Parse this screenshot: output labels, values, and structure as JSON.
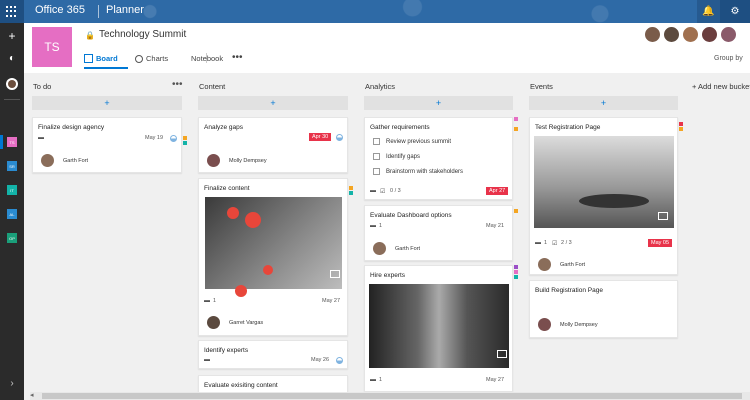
{
  "app": {
    "suite": "Office 365",
    "name": "Planner"
  },
  "rail": {
    "add_icon": "+",
    "hub_icon": "◐",
    "plans": [
      {
        "label": "TS",
        "color": "#e56ec3"
      },
      {
        "label": "SR",
        "color": "#2a8bd0"
      },
      {
        "label": "IT",
        "color": "#13b3a8"
      },
      {
        "label": "AL",
        "color": "#2a8bd0"
      },
      {
        "label": "OP",
        "color": "#1a9f7a"
      }
    ],
    "expand_icon": "›"
  },
  "plan": {
    "initials": "TS",
    "title": "Technology Summit",
    "tile_color": "#e56ec3",
    "tabs": [
      {
        "label": "Board",
        "active": true
      },
      {
        "label": "Charts",
        "active": false
      },
      {
        "label": "Notebook",
        "active": false
      }
    ],
    "more": "•••",
    "group_by": "Group by"
  },
  "buckets": [
    {
      "name": "To do",
      "more": "•••",
      "add": "+"
    },
    {
      "name": "Content",
      "add": "+"
    },
    {
      "name": "Analytics",
      "add": "+"
    },
    {
      "name": "Events",
      "add": "+"
    }
  ],
  "add_bucket": "+ Add new bucket",
  "cards": {
    "finalize_design": {
      "title": "Finalize design agency",
      "due": "May 19",
      "assignee": "Garth Fort"
    },
    "analyze_gaps": {
      "title": "Analyze gaps",
      "due": "Apr 30",
      "assignee": "Molly Dempsey"
    },
    "finalize_content": {
      "title": "Finalize content",
      "attachments": "1",
      "due": "May 27",
      "assignee": "Garret Vargas"
    },
    "identify_experts": {
      "title": "Identify experts",
      "due": "May 26"
    },
    "evaluate_content": {
      "title": "Evaluate exisiting content"
    },
    "gather_requirements": {
      "title": "Gather requirements",
      "checklist": [
        "Review previous summit",
        "Identify gaps",
        "Brainstorm with stakeholders"
      ],
      "progress": "0 / 3",
      "due": "Apr 27"
    },
    "evaluate_dashboard": {
      "title": "Evaluate Dashboard options",
      "attachments": "1",
      "due": "May 21",
      "assignee": "Garth Fort"
    },
    "hire_experts": {
      "title": "Hire experts",
      "attachments": "1",
      "due": "May 27"
    },
    "test_registration": {
      "title": "Test Registration Page",
      "attachments": "1",
      "progress": "2 / 3",
      "due": "May 05",
      "assignee": "Garth Fort"
    },
    "build_registration": {
      "title": "Build Registration Page",
      "assignee": "Molly Dempsey"
    }
  },
  "colors": {
    "overdue": "#e8334a",
    "accent": "#0078d4",
    "label_orange": "#f4a522",
    "label_teal": "#13b3a8",
    "label_pink": "#e56ec3",
    "label_purple": "#9b4fc7",
    "label_red": "#e8334a"
  }
}
